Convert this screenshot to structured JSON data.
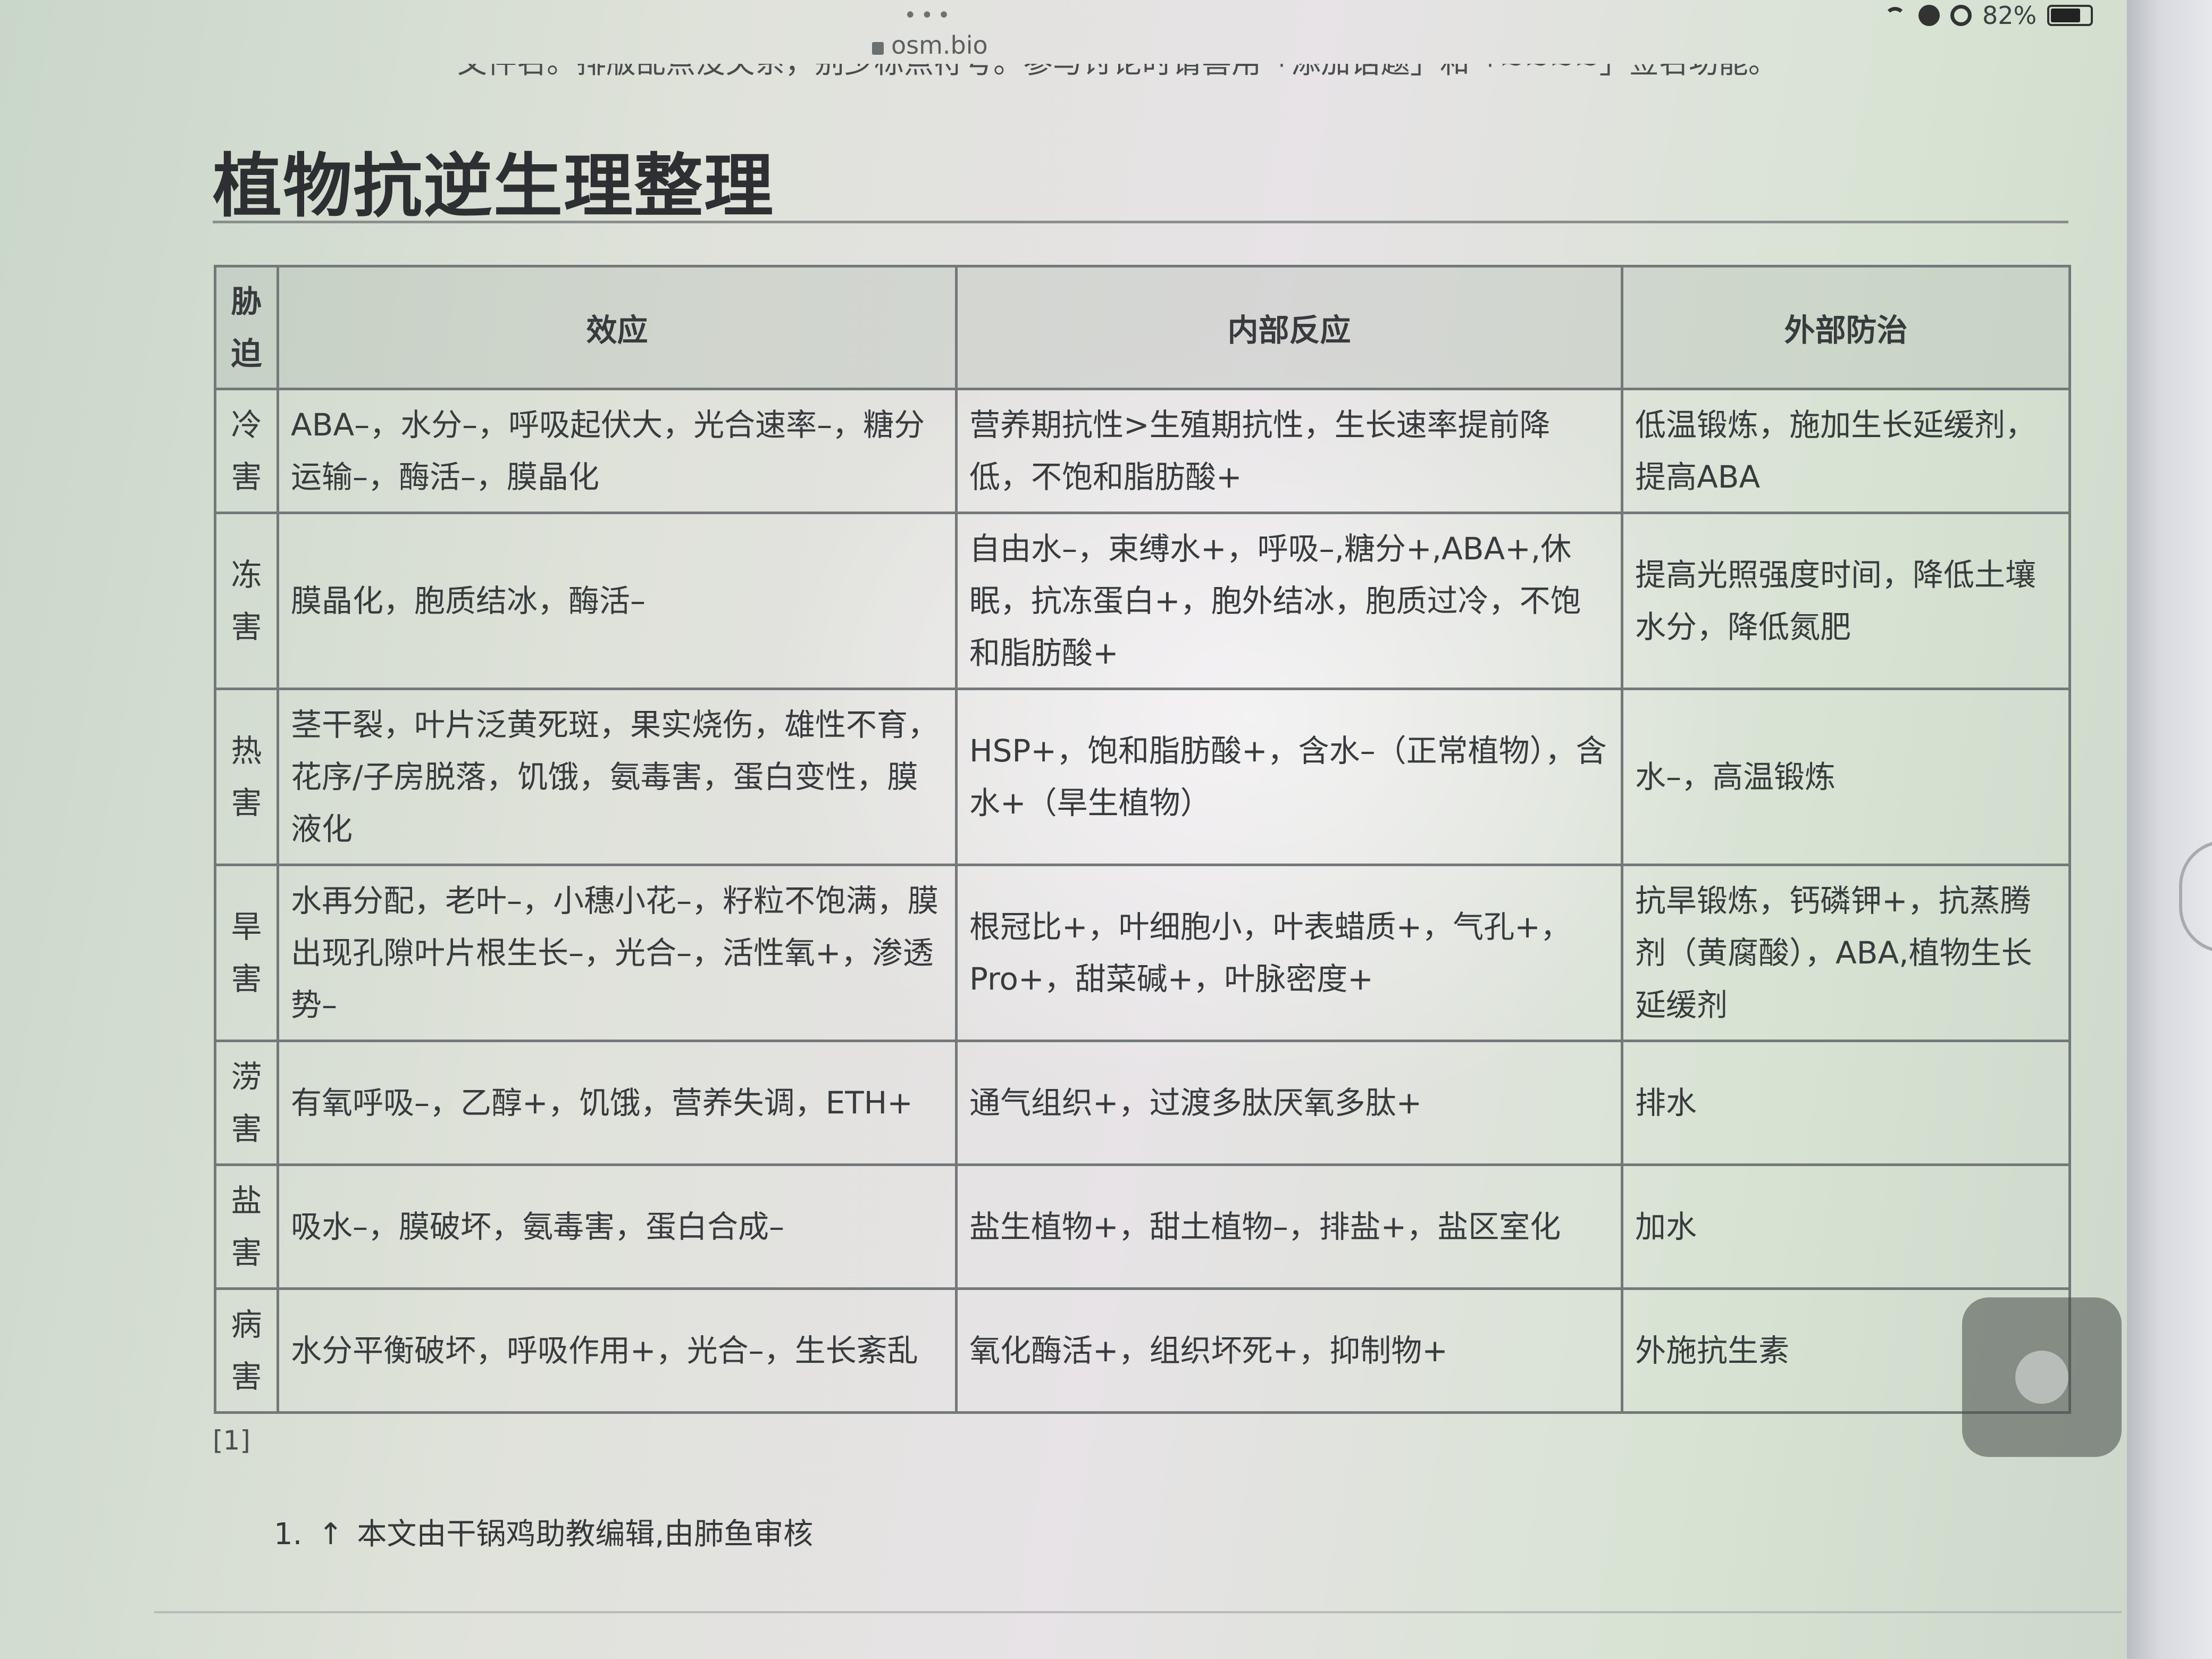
{
  "status_bar": {
    "dots": "•••",
    "url": "osm.bio",
    "battery": "82%"
  },
  "page": {
    "clipped_text": "文件名。排版乱点没关系，别少标点符号。参与讨论时请善用「添加话题」和「~~~~」签名功能。",
    "title": "植物抗逆生理整理",
    "table": {
      "headers": [
        "胁迫",
        "效应",
        "内部反应",
        "外部防治"
      ],
      "rows": [
        {
          "stress": "冷害",
          "effect": "ABA–，水分–，呼吸起伏大，光合速率–，糖分运输–，酶活–，膜晶化",
          "internal": "营养期抗性>生殖期抗性，生长速率提前降低，不饱和脂肪酸+",
          "external": "低温锻炼，施加生长延缓剂，提高ABA"
        },
        {
          "stress": "冻害",
          "effect": "膜晶化，胞质结冰，酶活–",
          "internal": "自由水–，束缚水+，呼吸–,糖分+,ABA+,休眠，抗冻蛋白+，胞外结冰，胞质过冷，不饱和脂肪酸+",
          "external": "提高光照强度时间，降低土壤水分，降低氮肥"
        },
        {
          "stress": "热害",
          "effect": "茎干裂，叶片泛黄死斑，果实烧伤，雄性不育，花序/子房脱落，饥饿，氨毒害，蛋白变性，膜液化",
          "internal": "HSP+，饱和脂肪酸+，含水–（正常植物），含水+（旱生植物）",
          "external": "水–，高温锻炼"
        },
        {
          "stress": "旱害",
          "effect": "水再分配，老叶–，小穗小花–，籽粒不饱满，膜出现孔隙叶片根生长–，光合–，活性氧+，渗透势–",
          "internal": "根冠比+，叶细胞小，叶表蜡质+，气孔+，Pro+，甜菜碱+，叶脉密度+",
          "external": "抗旱锻炼，钙磷钾+，抗蒸腾剂（黄腐酸），ABA,植物生长延缓剂"
        },
        {
          "stress": "涝害",
          "effect": "有氧呼吸–，乙醇+，饥饿，营养失调，ETH+",
          "internal": "通气组织+，过渡多肽厌氧多肽+",
          "external": "排水"
        },
        {
          "stress": "盐害",
          "effect": "吸水–，膜破坏，氨毒害，蛋白合成–",
          "internal": "盐生植物+，甜土植物–，排盐+，盐区室化",
          "external": "加水"
        },
        {
          "stress": "病害",
          "effect": "水分平衡破坏，呼吸作用+，光合–，生长紊乱",
          "internal": "氧化酶活+，组织坏死+，抑制物+",
          "external": "外施抗生素"
        }
      ]
    },
    "footnote_ref": "[1]",
    "footnote": {
      "number": "1.",
      "arrow": "↑",
      "text": "本文由干锅鸡助教编辑,由肺鱼审核"
    }
  }
}
